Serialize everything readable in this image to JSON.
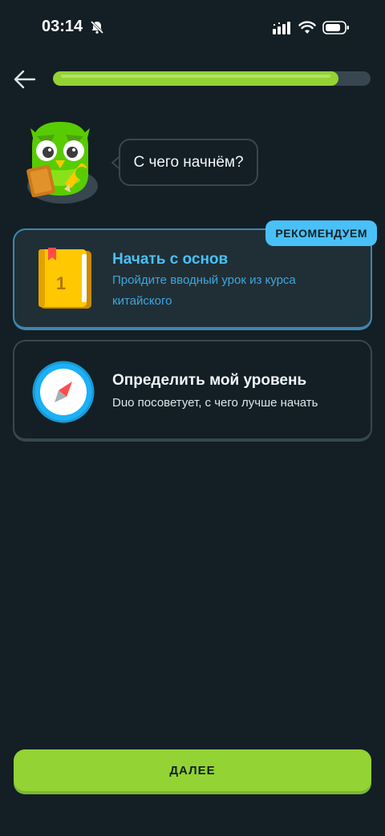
{
  "status_bar": {
    "time": "03:14"
  },
  "progress": {
    "value_percent": 90
  },
  "speech": {
    "text": "С чего начнём?"
  },
  "options": [
    {
      "badge": "РЕКОМЕНДУЕМ",
      "title": "Начать с основ",
      "description": "Пройдите вводный урок из курса китайского",
      "icon": "book-icon",
      "icon_number": "1"
    },
    {
      "title": "Определить мой уровень",
      "description": "Duo посоветует, с чего лучше начать",
      "icon": "compass-icon"
    }
  ],
  "footer": {
    "continue_label": "ДАЛЕЕ"
  },
  "colors": {
    "background": "#131f24",
    "accent_green": "#93d333",
    "accent_blue": "#49c0f8",
    "border": "#37464f"
  }
}
